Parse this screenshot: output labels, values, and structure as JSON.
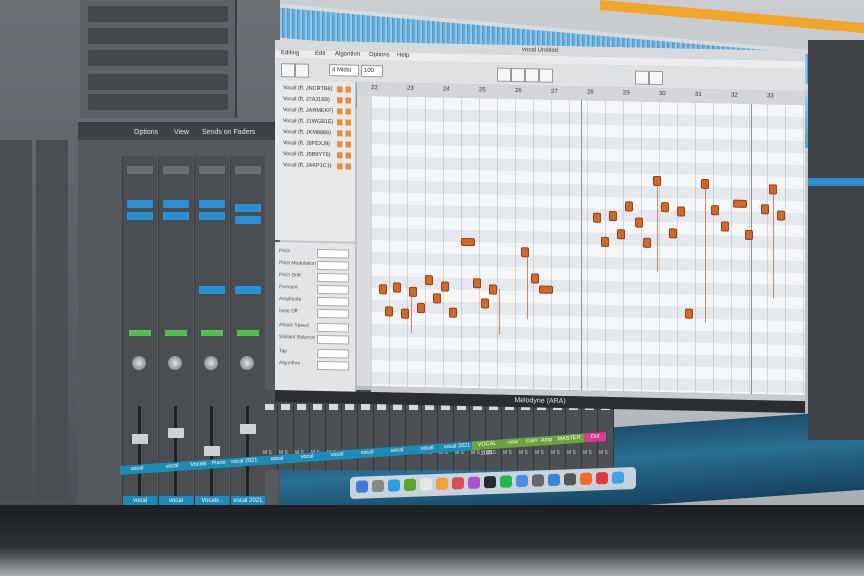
{
  "melodyne": {
    "window_title": "Melodyne (ARA)",
    "doc_title": "vocal Untitled",
    "menu": [
      "Editing",
      "Edit",
      "Algorithm",
      "Options",
      "Help"
    ],
    "toolbar_field_1": "4 Midst",
    "toolbar_field_2": "100",
    "ruler_marks": [
      "22",
      "23",
      "24",
      "25",
      "26",
      "27",
      "28",
      "29",
      "30",
      "31",
      "32",
      "33"
    ],
    "tracks": [
      "Vocal (ft. JNCRTB6)",
      "Vocal (ft. J7AJ1B9)",
      "Vocal (ft. JARMEKF)",
      "Vocal (ft. J1WGB1E)",
      "Vocal (ft. JKM8886)",
      "Vocal (ft. J8FEXJ9)",
      "Vocal (ft. J0B9YT6)",
      "Vocal (ft. JAKP1C1)"
    ],
    "inspector": [
      "Pitch",
      "Pitch Modulation",
      "Pitch Drift",
      "Formant",
      "Amplitude",
      "Note Off",
      "Attack Speed",
      "Sibilant Balance",
      "Tap",
      "Algorithm"
    ]
  },
  "mixer": {
    "titlebar": [
      "Options",
      "View",
      "Sends on Faders"
    ],
    "strip_names": [
      "vocal",
      "vocal",
      "Vocals · Piano",
      "vocal 2021"
    ],
    "lower_labels": [
      "vocal",
      "vocal",
      "vocal",
      "vocal",
      "vocal",
      "vocal",
      "vocal 2021",
      "VOCAL 2021",
      "new",
      "Gain ·Amp",
      "MASTER",
      "Out"
    ]
  },
  "colors": {
    "note": "#d06a28",
    "strip_label": "#1a8cb6",
    "accent_orange": "#f1a629",
    "meter_green": "#4fc24a",
    "insert_blue": "#2b8fd6",
    "master_pink": "#d93c8e"
  }
}
